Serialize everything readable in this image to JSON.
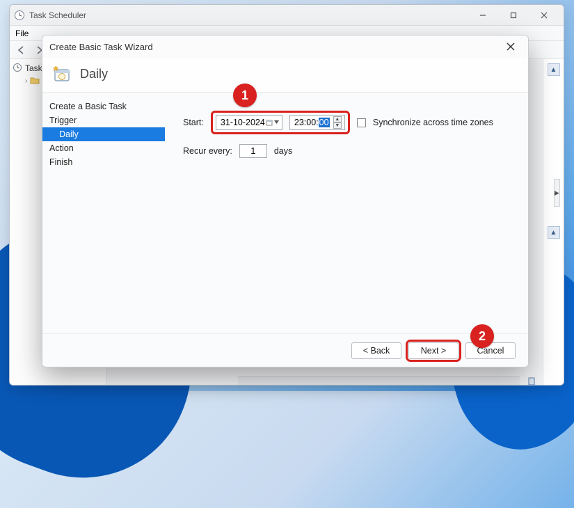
{
  "app": {
    "title": "Task Scheduler",
    "menu_file": "File"
  },
  "tree": {
    "root_label": "Task Scheduler",
    "lib_label": ""
  },
  "dialog": {
    "title": "Create Basic Task Wizard",
    "heading": "Daily",
    "steps": {
      "create": "Create a Basic Task",
      "trigger": "Trigger",
      "daily": "Daily",
      "action": "Action",
      "finish": "Finish"
    },
    "form": {
      "start_label": "Start:",
      "date_value": "31-10-2024",
      "time_prefix": "23:00:",
      "time_seconds": "00",
      "sync_label": "Synchronize across time zones",
      "recur_label": "Recur every:",
      "recur_value": "1",
      "recur_unit": "days"
    },
    "buttons": {
      "back": "< Back",
      "next": "Next >",
      "cancel": "Cancel"
    }
  },
  "annotations": {
    "badge1": "1",
    "badge2": "2"
  }
}
